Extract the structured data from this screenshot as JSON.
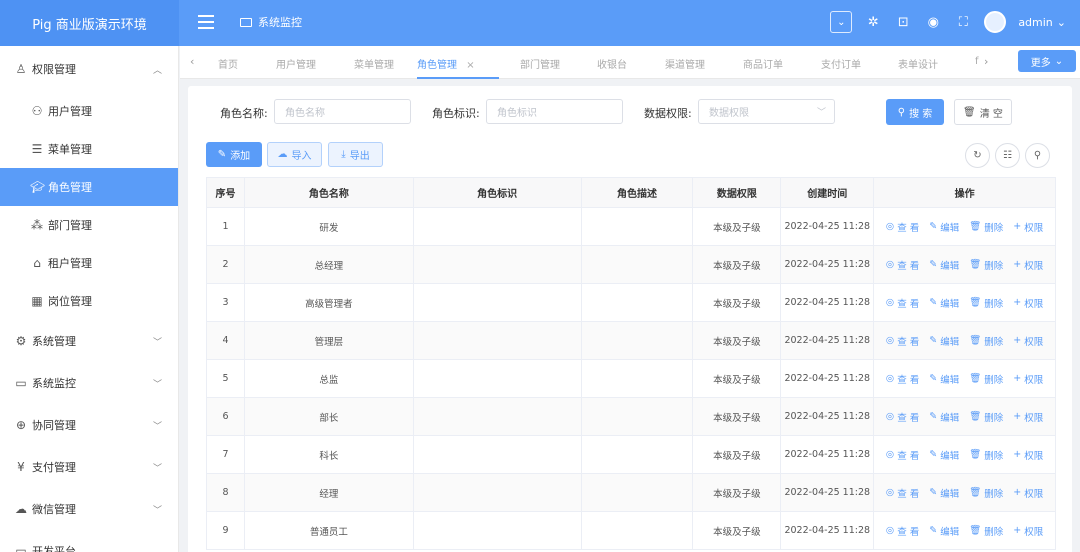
{
  "app": {
    "title": "Pig 商业版演示环境"
  },
  "header": {
    "breadcrumb": "系统监控",
    "username": "admin"
  },
  "sidebar": {
    "items": [
      {
        "label": "权限管理",
        "icon": "user-icon"
      },
      {
        "label": "用户管理",
        "icon": "users-icon"
      },
      {
        "label": "菜单管理",
        "icon": "list-icon"
      },
      {
        "label": "角色管理",
        "icon": "graduation-cap-icon"
      },
      {
        "label": "部门管理",
        "icon": "org-icon"
      },
      {
        "label": "租户管理",
        "icon": "home-icon"
      },
      {
        "label": "岗位管理",
        "icon": "grid-icon"
      },
      {
        "label": "系统管理",
        "icon": "gear-icon"
      },
      {
        "label": "系统监控",
        "icon": "monitor-icon"
      },
      {
        "label": "协同管理",
        "icon": "circle-icon"
      },
      {
        "label": "支付管理",
        "icon": "yen-icon"
      },
      {
        "label": "微信管理",
        "icon": "wechat-icon"
      },
      {
        "label": "开发平台",
        "icon": "code-icon"
      }
    ]
  },
  "tabs": {
    "items": [
      "首页",
      "用户管理",
      "菜单管理",
      "角色管理",
      "部门管理",
      "收银台",
      "渠道管理",
      "商品订单",
      "支付订单",
      "表单设计",
      "f"
    ],
    "active": "角色管理",
    "more_label": "更多"
  },
  "filters": {
    "role_name_label": "角色名称:",
    "role_name_placeholder": "角色名称",
    "role_code_label": "角色标识:",
    "role_code_placeholder": "角色标识",
    "scope_label": "数据权限:",
    "scope_placeholder": "数据权限",
    "search_label": "搜 索",
    "clear_label": "清 空"
  },
  "toolbar": {
    "add_label": "添加",
    "import_label": "导入",
    "export_label": "导出"
  },
  "table": {
    "headers": [
      "序号",
      "角色名称",
      "角色标识",
      "角色描述",
      "数据权限",
      "创建时间",
      "操作"
    ],
    "actions": {
      "view": "查 看",
      "edit": "编辑",
      "delete": "删除",
      "perm": "权限"
    },
    "rows": [
      {
        "index": "1",
        "name": "研发",
        "code": "",
        "desc": "",
        "scope": "本级及子级",
        "created": "2022-04-25 11:28"
      },
      {
        "index": "2",
        "name": "总经理",
        "code": "",
        "desc": "",
        "scope": "本级及子级",
        "created": "2022-04-25 11:28"
      },
      {
        "index": "3",
        "name": "高级管理者",
        "code": "",
        "desc": "",
        "scope": "本级及子级",
        "created": "2022-04-25 11:28"
      },
      {
        "index": "4",
        "name": "管理层",
        "code": "",
        "desc": "",
        "scope": "本级及子级",
        "created": "2022-04-25 11:28"
      },
      {
        "index": "5",
        "name": "总监",
        "code": "",
        "desc": "",
        "scope": "本级及子级",
        "created": "2022-04-25 11:28"
      },
      {
        "index": "6",
        "name": "部长",
        "code": "",
        "desc": "",
        "scope": "本级及子级",
        "created": "2022-04-25 11:28"
      },
      {
        "index": "7",
        "name": "科长",
        "code": "",
        "desc": "",
        "scope": "本级及子级",
        "created": "2022-04-25 11:28"
      },
      {
        "index": "8",
        "name": "经理",
        "code": "",
        "desc": "",
        "scope": "本级及子级",
        "created": "2022-04-25 11:28"
      },
      {
        "index": "9",
        "name": "普通员工",
        "code": "",
        "desc": "",
        "scope": "本级及子级",
        "created": "2022-04-25 11:28"
      }
    ]
  },
  "colors": {
    "primary": "#5a9cf8",
    "header": "#5a9cf8",
    "brand_bg": "#4e92f3"
  }
}
